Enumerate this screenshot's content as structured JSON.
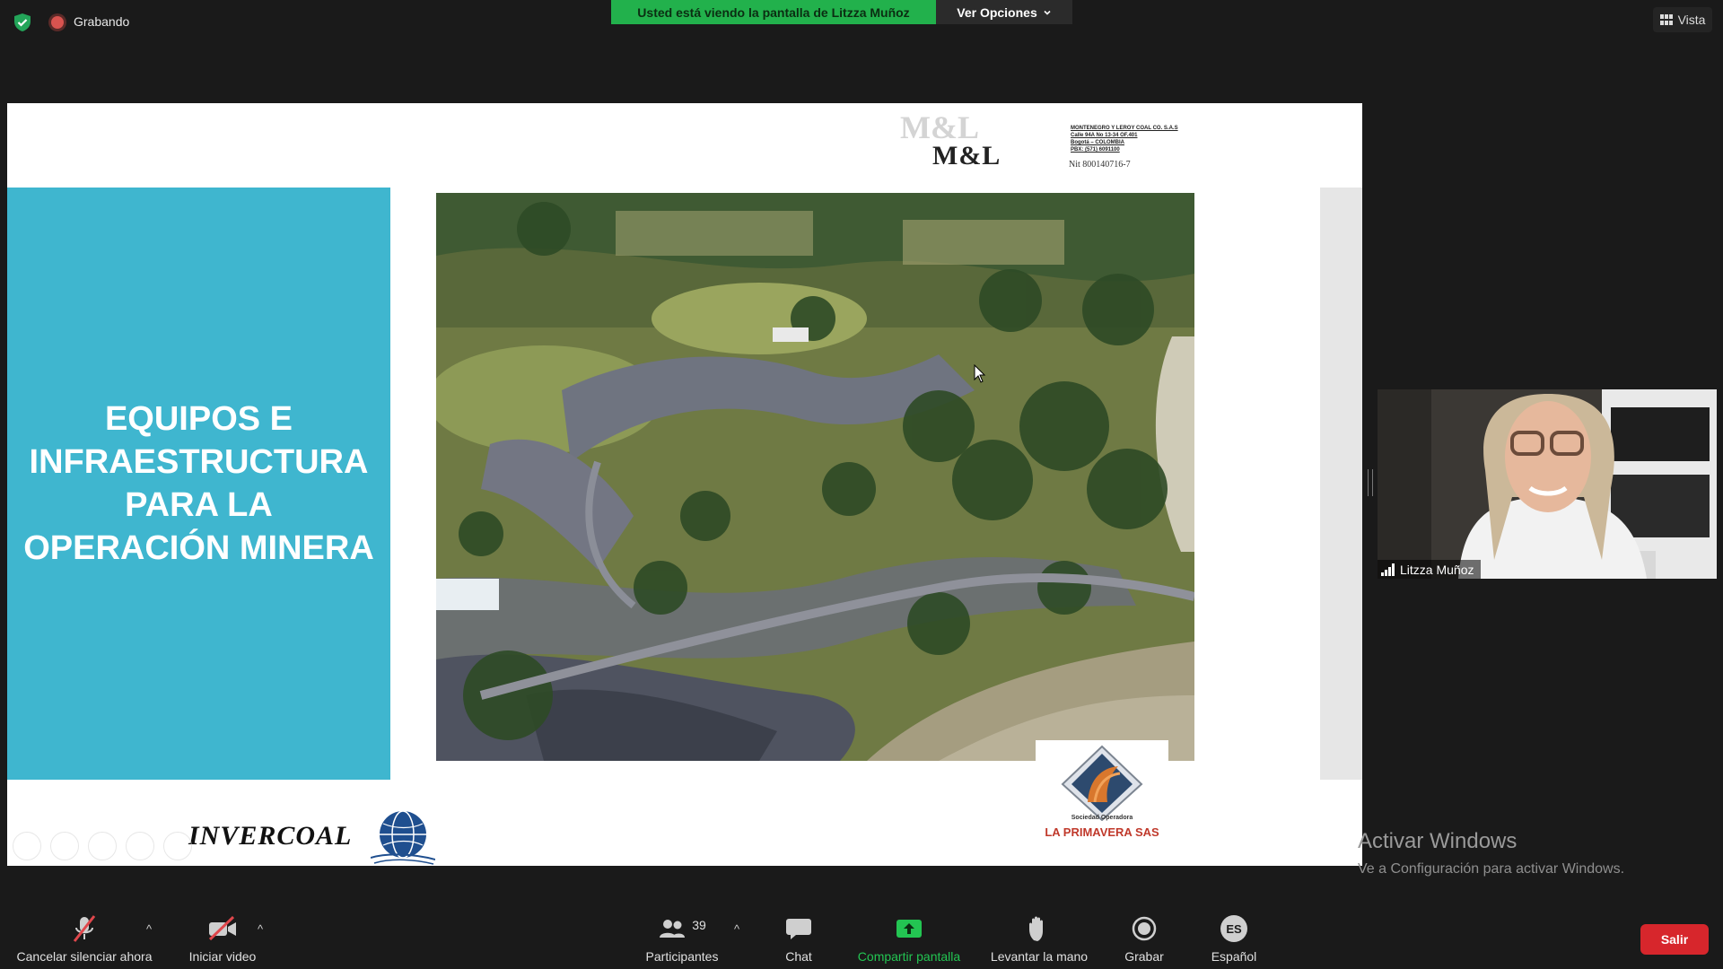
{
  "topbar": {
    "recording_label": "Grabando",
    "viewing_banner": "Usted está viendo la pantalla de Litzza Muñoz",
    "view_options": "Ver Opciones",
    "view_button": "Vista"
  },
  "slide": {
    "title_lines": [
      "EQUIPOS E",
      "INFRAESTRUCTURA",
      "PARA LA",
      "OPERACIÓN MINERA"
    ],
    "ml_logo": "M&L",
    "company_lines": [
      "MONTENEGRO Y LEROY COAL CO. S.A.S",
      "Calle 94A No 13-34 OF.401",
      "Bogotá – COLOMBIA",
      "PBX: (571) 6091100"
    ],
    "nit": "Nit 800140716-7",
    "primavera_sub": "Sociedad Operadora",
    "primavera_name": "LA PRIMAVERA SAS",
    "invercoal": "INVERCOAL"
  },
  "watermark": {
    "line1": "Activar Windows",
    "line2": "Ve a Configuración para activar Windows."
  },
  "video": {
    "participant_name": "Litzza Muñoz"
  },
  "toolbar": {
    "unmute": "Cancelar silenciar ahora",
    "start_video": "Iniciar video",
    "participants": "Participantes",
    "participants_count": "39",
    "chat": "Chat",
    "share_screen": "Compartir pantalla",
    "raise_hand": "Levantar la mano",
    "record": "Grabar",
    "language": "Español",
    "language_badge": "ES",
    "leave": "Salir"
  },
  "colors": {
    "banner_green": "#22b14c",
    "slide_teal": "#3fb6cf",
    "leave_red": "#d7262c"
  }
}
